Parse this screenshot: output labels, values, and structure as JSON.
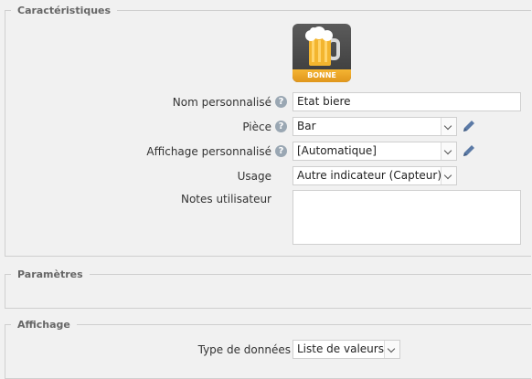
{
  "sections": {
    "caracteristiques": "Caractéristiques",
    "parametres": "Paramètres",
    "affichage": "Affichage"
  },
  "device_icon": {
    "name": "beer-mug-icon",
    "status_label": "BONNE"
  },
  "fields": {
    "nom": {
      "label": "Nom personnalisé",
      "value": "Etat biere"
    },
    "piece": {
      "label": "Pièce",
      "value": "Bar"
    },
    "affichage": {
      "label": "Affichage personnalisé",
      "value": "[Automatique]"
    },
    "usage": {
      "label": "Usage",
      "value": "Autre indicateur (Capteur)"
    },
    "notes": {
      "label": "Notes utilisateur",
      "value": ""
    },
    "type": {
      "label": "Type de données",
      "value": "Liste de valeurs"
    }
  },
  "help_glyph": "?",
  "colors": {
    "accent": "#f5b533",
    "help": "#9aa7b3",
    "pencil": "#5b7aa6"
  }
}
